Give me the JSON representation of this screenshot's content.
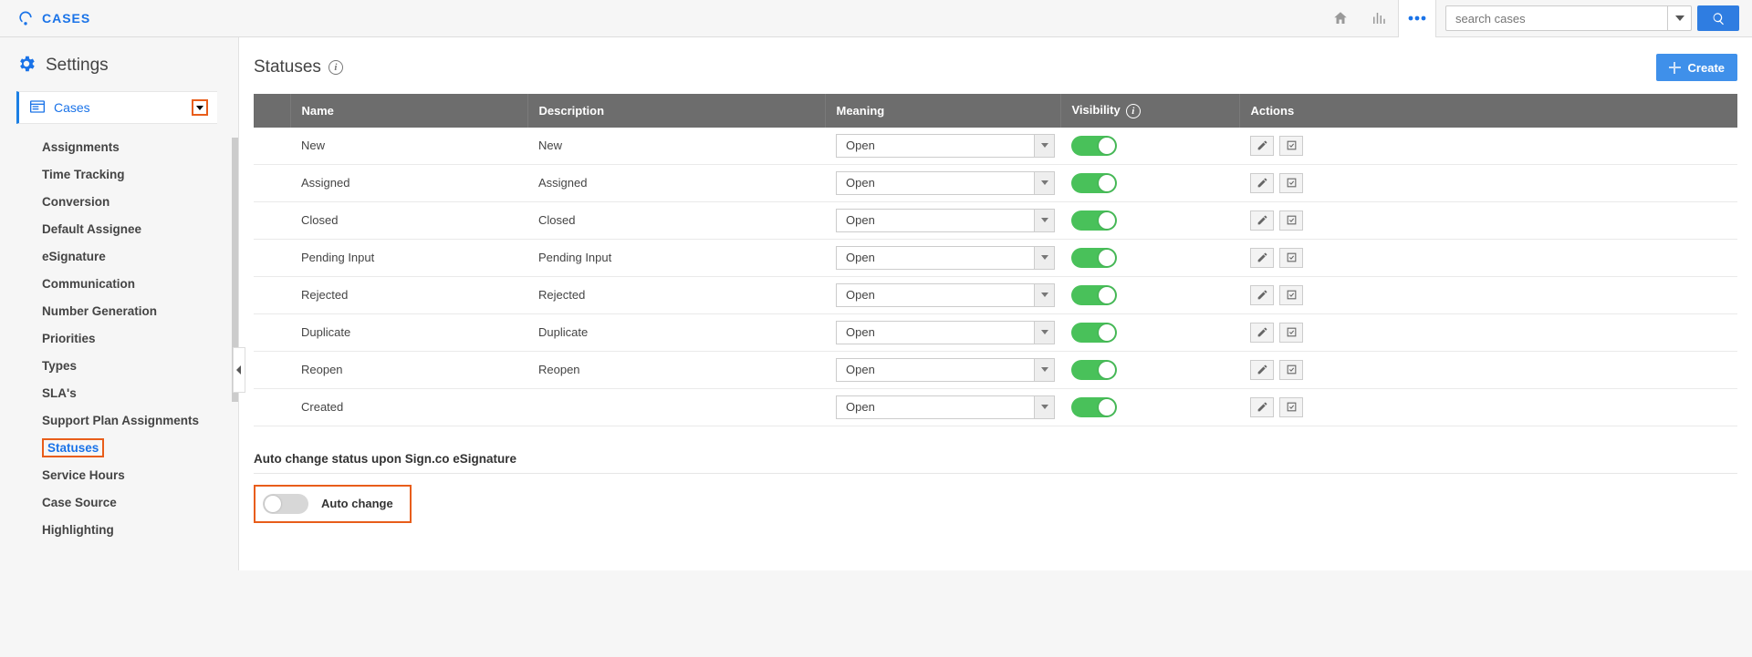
{
  "header": {
    "app_name": "CASES",
    "search_placeholder": "search cases"
  },
  "sidebar": {
    "settings_label": "Settings",
    "top_nav_label": "Cases",
    "items": [
      "Assignments",
      "Time Tracking",
      "Conversion",
      "Default Assignee",
      "eSignature",
      "Communication",
      "Number Generation",
      "Priorities",
      "Types",
      "SLA's",
      "Support Plan Assignments",
      "Statuses",
      "Service Hours",
      "Case Source",
      "Highlighting"
    ],
    "selected_index": 11
  },
  "page": {
    "title": "Statuses",
    "create_label": "Create"
  },
  "columns": {
    "name": "Name",
    "description": "Description",
    "meaning": "Meaning",
    "visibility": "Visibility",
    "actions": "Actions"
  },
  "rows": [
    {
      "name": "New",
      "description": "New",
      "meaning": "Open",
      "visible": true
    },
    {
      "name": "Assigned",
      "description": "Assigned",
      "meaning": "Open",
      "visible": true
    },
    {
      "name": "Closed",
      "description": "Closed",
      "meaning": "Open",
      "visible": true
    },
    {
      "name": "Pending Input",
      "description": "Pending Input",
      "meaning": "Open",
      "visible": true
    },
    {
      "name": "Rejected",
      "description": "Rejected",
      "meaning": "Open",
      "visible": true
    },
    {
      "name": "Duplicate",
      "description": "Duplicate",
      "meaning": "Open",
      "visible": true
    },
    {
      "name": "Reopen",
      "description": "Reopen",
      "meaning": "Open",
      "visible": true
    },
    {
      "name": "Created",
      "description": "",
      "meaning": "Open",
      "visible": true
    }
  ],
  "auto_change": {
    "heading": "Auto change status upon Sign.co eSignature",
    "label": "Auto change",
    "enabled": false
  }
}
